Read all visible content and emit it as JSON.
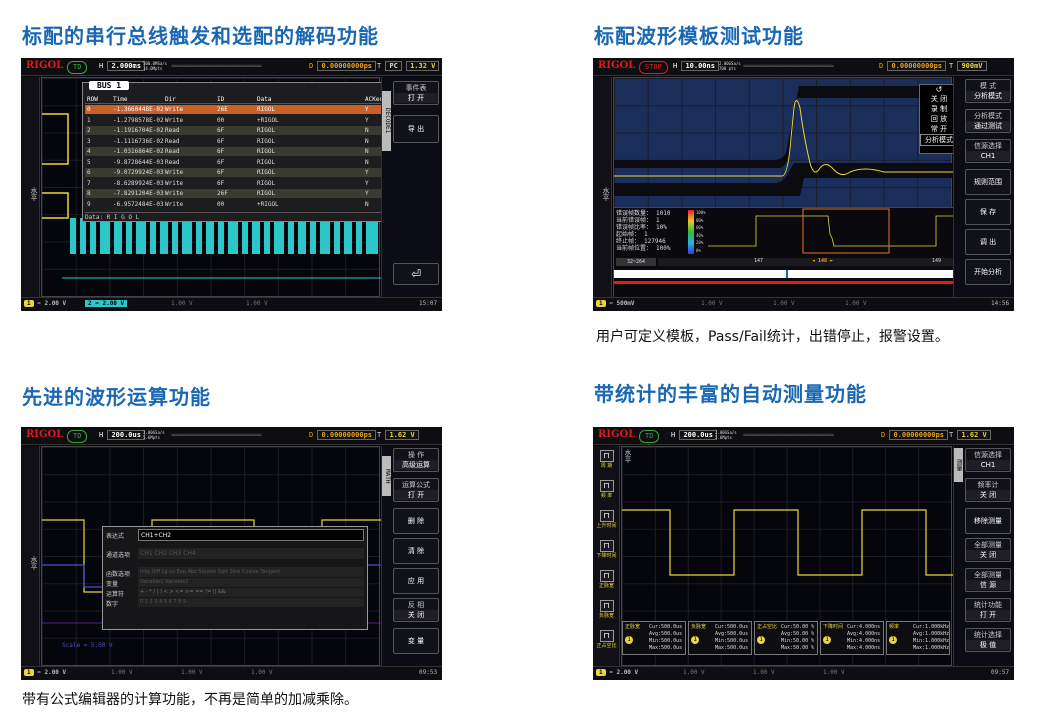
{
  "sections": {
    "s1_title": "标配的串行总线触发和选配的解码功能",
    "s2_title": "标配波形模板测试功能",
    "s2_caption": "用户可定义模板，Pass/Fail统计，出错停止，报警设置。",
    "s3_title": "先进的波形运算功能",
    "s3_caption": "带有公式编辑器的计算功能，不再是简单的加减乘除。",
    "s4_title": "带统计的丰富的自动测量功能"
  },
  "scope1": {
    "logo": "RIGOL",
    "state": "TD",
    "timebase": "2.000ms",
    "rate": "500.0MSa/s\n14.0Mpts",
    "delay": "0.00000000ps",
    "trig": "PC",
    "trig_level": "1.32 V",
    "vertical_tab": "水平",
    "table_title": "BUS 1",
    "table_headers": [
      "ROW",
      "Time",
      "Dir",
      "ID",
      "Data",
      "ACKed"
    ],
    "table_rows": [
      [
        "0",
        "-1.3660448E-02",
        "Write",
        "26E",
        "RIGOL",
        "Y"
      ],
      [
        "1",
        "-1.2798578E-02",
        "Write",
        "00",
        "+RIGOL",
        "Y"
      ],
      [
        "2",
        "-1.1916704E-02",
        "Read",
        "6F",
        "RIGOL",
        "N"
      ],
      [
        "3",
        "-1.1116736E-02",
        "Read",
        "6F",
        "RIGOL",
        "N"
      ],
      [
        "4",
        "-1.0316864E-02",
        "Read",
        "6F",
        "RIGOL",
        "N"
      ],
      [
        "5",
        "-9.8728644E-03",
        "Read",
        "6F",
        "RIGOL",
        "N"
      ],
      [
        "6",
        "-9.0729924E-03",
        "Write",
        "6F",
        "RIGOL",
        "Y"
      ],
      [
        "7",
        "-8.6289924E-03",
        "Write",
        "6F",
        "RIGOL",
        "Y"
      ],
      [
        "8",
        "-7.8291204E-03",
        "Write",
        "26F",
        "RIGOL",
        "Y"
      ],
      [
        "9",
        "-6.9572484E-03",
        "Write",
        "00",
        "+RIGOL",
        "N"
      ]
    ],
    "data_footer": "Data: R I G O L",
    "decode_tab": "DECODE1",
    "event_tab": "事件表",
    "menu": [
      {
        "a": "事件表",
        "b": "打 开"
      },
      {
        "a": "导 出",
        "b": ""
      }
    ],
    "bottom": {
      "ch1": "1",
      "ch1v": "2.00 V",
      "ch2": "2",
      "ch2v": "2.00 V",
      "ch3v": "1.00 V",
      "ch4v": "1.00 V",
      "time": "15:07"
    }
  },
  "scope2": {
    "logo": "RIGOL",
    "state": "STOP",
    "timebase": "10.00ns",
    "rate": "2.00GSa/s\n700 pts",
    "delay": "0.00000000ps",
    "trig_level": "900mV",
    "vertical_tab": "水平",
    "popup": [
      "关 闭",
      "录 制",
      "回 放",
      "常 开",
      "分析模式"
    ],
    "menu": [
      {
        "a": "模 式",
        "b": "分析模式"
      },
      {
        "a": "分析模式",
        "b": "通过测试"
      },
      {
        "a": "信源选择",
        "b": "CH1"
      },
      {
        "a": "规则范围",
        "b": ""
      },
      {
        "a": "保 存",
        "b": ""
      },
      {
        "a": "调 出",
        "b": ""
      },
      {
        "a": "开始分析",
        "b": ""
      }
    ],
    "stats": [
      [
        "错误帧数量：",
        "1010"
      ],
      [
        "当前错误帧：",
        "1"
      ],
      [
        "错误帧比率：",
        "10%"
      ],
      [
        "起始帧：",
        "1"
      ],
      [
        "终止帧：",
        "127946"
      ],
      [
        "当前帧位置：",
        "100%"
      ]
    ],
    "scale": [
      "100%",
      "80%",
      "60%",
      "40%",
      "20%",
      "0%"
    ],
    "range": "32~264",
    "frames": [
      "147",
      "148",
      "149"
    ],
    "bottom": {
      "ch1v": "500mV",
      "ch2v": "1.00 V",
      "ch3v": "1.00 V",
      "ch4v": "1.00 V",
      "time": "14:56"
    }
  },
  "scope3": {
    "logo": "RIGOL",
    "state": "TD",
    "timebase": "200.0us",
    "rate": "2.00GSa/s\n5.6Mpts",
    "delay": "0.00000000ps",
    "trig_level": "1.62 V",
    "vertical_tab": "水平",
    "math_tab": "MATH",
    "menu": [
      {
        "a": "操 作",
        "b": "高级运算"
      },
      {
        "a": "运算公式",
        "b": "打 开"
      },
      {
        "a": "删 除",
        "b": ""
      },
      {
        "a": "清 除",
        "b": ""
      },
      {
        "a": "应 用",
        "b": ""
      },
      {
        "a": "反 相",
        "b": "关 闭"
      },
      {
        "a": "变 量",
        "b": ""
      }
    ],
    "editor": {
      "expr_label": "表达式",
      "expr": "CH1+CH2",
      "ch_label": "通道选项",
      "ch_items": "CH1 CH2 CH3 CH4",
      "fn_label": "函数选项",
      "fn_items": "Intg  Diff  Lg  Ln  Exp  Abs  Square  Sqrt  Sine  Cosine  Tangent",
      "var_label": "变量",
      "var_items": "Variable1  Variable2",
      "op_label": "运算符",
      "op_items": "+  -  *  /  (  )  <  >  <=  >=  ==  !=  ||  &&",
      "num_label": "数字",
      "num_items": "0  1  2  3  4  5  6  7  8  9  ."
    },
    "math_scale": "Scale = 5.00 V",
    "bottom": {
      "ch1v": "2.00 V",
      "ch2v": "1.00 V",
      "ch3v": "1.00 V",
      "ch4v": "1.00 V",
      "time": "09:53"
    }
  },
  "scope4": {
    "logo": "RIGOL",
    "state": "TD",
    "timebase": "200.0us",
    "rate": "2.00GSa/s\n5.6Mpts",
    "delay": "0.00000000ps",
    "trig_level": "1.62 V",
    "vertical_tab": "水平",
    "measure_tab": "测量",
    "left_icons": [
      "周 期",
      "频 率",
      "上升时间",
      "下降时间",
      "正脉宽",
      "负脉宽",
      "正占空比"
    ],
    "menu": [
      {
        "a": "信源选择",
        "b": "CH1"
      },
      {
        "a": "频率计",
        "b": "关 闭"
      },
      {
        "a": "移除测量",
        "b": ""
      },
      {
        "a": "全部测量",
        "b": "关 闭"
      },
      {
        "a": "全部测量",
        "b": "信 源"
      },
      {
        "a": "统计功能",
        "b": "打 开"
      },
      {
        "a": "统计选择",
        "b": "极 值"
      }
    ],
    "measures": [
      {
        "name": "正脉宽",
        "cur": "500.0us",
        "avg": "500.0us",
        "min": "500.0us",
        "max": "500.0us"
      },
      {
        "name": "负脉宽",
        "cur": "500.0us",
        "avg": "500.0us",
        "min": "500.0us",
        "max": "500.0us"
      },
      {
        "name": "正占空比",
        "cur": "50.00 %",
        "avg": "50.00 %",
        "min": "50.00 %",
        "max": "50.00 %"
      },
      {
        "name": "下降时间",
        "cur": "4.000ns",
        "avg": "4.000ns",
        "min": "4.000ns",
        "max": "4.000ns"
      },
      {
        "name": "频率",
        "cur": "1.000kHz",
        "avg": "1.000kHz",
        "min": "1.000kHz",
        "max": "1.000kHz"
      }
    ],
    "bottom": {
      "ch1v": "2.00 V",
      "ch2v": "1.00 V",
      "ch3v": "1.00 V",
      "ch4v": "1.00 V",
      "time": "09:57"
    }
  }
}
